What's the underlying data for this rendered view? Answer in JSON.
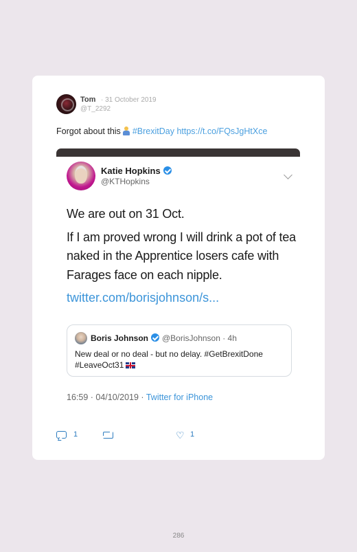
{
  "post": {
    "author_name": "Tom",
    "date": "· 31 October 2019",
    "handle": "@T_2292",
    "text_prefix": "Forgot about this",
    "hashtag": "#BrexitDay",
    "link": "https://t.co/FQsJgHtXce"
  },
  "embedded_tweet": {
    "author_name": "Katie Hopkins",
    "handle": "@KTHopkins",
    "lines": [
      "We are out on 31 Oct.",
      "If I am proved wrong I will drink a pot of tea",
      "naked in the Apprentice losers cafe with",
      "Farages face on each nipple."
    ],
    "link": "twitter.com/borisjohnson/s...",
    "quoted": {
      "author_name": "Boris Johnson",
      "handle_time": "@BorisJohnson · 4h",
      "line1": "New deal or no deal - but no delay. #GetBrexitDone",
      "line2": "#LeaveOct31"
    },
    "timestamp": "16:59 · 04/10/2019 ·",
    "source": "Twitter for iPhone"
  },
  "actions": {
    "reply_count": "1",
    "like_count": "1"
  },
  "page_number": "286",
  "colors": {
    "background": "#ece6ec",
    "link": "#4a9fdf",
    "action": "#2b7bbf"
  }
}
